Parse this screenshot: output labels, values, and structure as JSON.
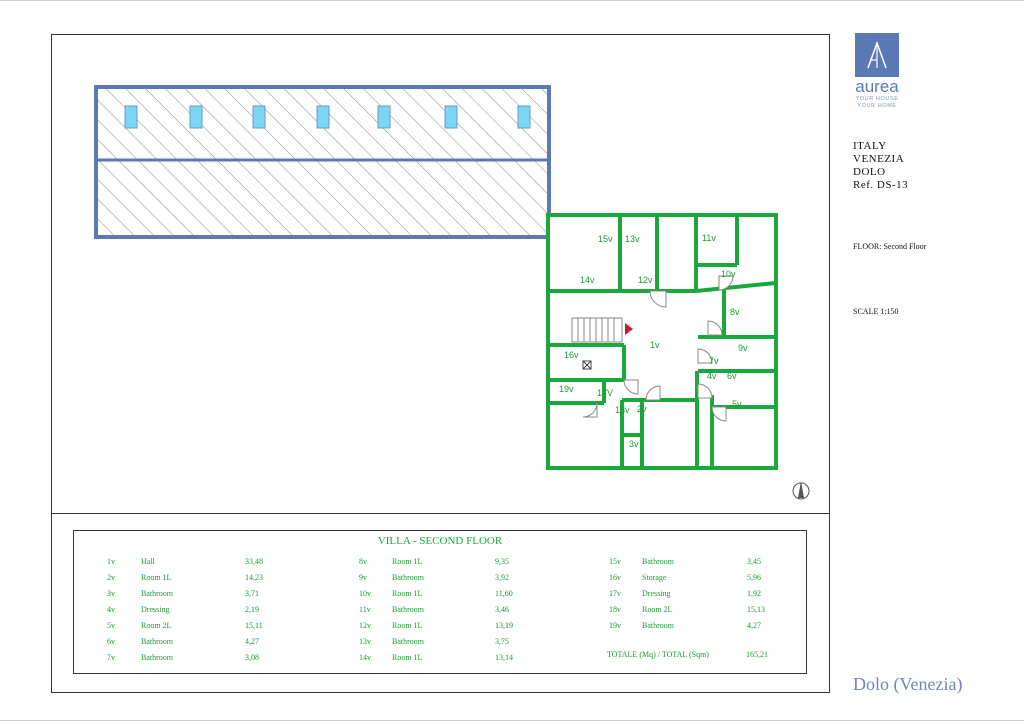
{
  "brand": {
    "name": "aurea",
    "tagline_1": "YOUR HOUSE",
    "tagline_2": "YOUR HOME"
  },
  "location": {
    "country": "ITALY",
    "city": "VENEZIA",
    "town": "DOLO",
    "ref": "Ref. DS-13"
  },
  "floor": "FLOOR: Second Floor",
  "scale": "SCALE 1:150",
  "footer_title": "Dolo (Venezia)",
  "colors": {
    "wall": "#1aa83a",
    "roof": "#5b7ab5",
    "skylight": "#7fd6f2",
    "accent": "#6f86b8"
  },
  "room_labels": [
    "1v",
    "2v",
    "3v",
    "4v",
    "5v",
    "6v",
    "7v",
    "8v",
    "9v",
    "10v",
    "11v",
    "12v",
    "13v",
    "14v",
    "15v",
    "16v",
    "17V",
    "18v",
    "19v"
  ],
  "legend": {
    "title": "VILLA - SECOND FLOOR",
    "columns": [
      [
        {
          "id": "1v",
          "name": "Hall",
          "area": "33,48"
        },
        {
          "id": "2v",
          "name": "Room 1L",
          "area": "14,23"
        },
        {
          "id": "3v",
          "name": "Bathroom",
          "area": "3,71"
        },
        {
          "id": "4v",
          "name": "Dressing",
          "area": "2,19"
        },
        {
          "id": "5v",
          "name": "Room 2L",
          "area": "15,11"
        },
        {
          "id": "6v",
          "name": "Bathroom",
          "area": "4,27"
        },
        {
          "id": "7v",
          "name": "Bathroom",
          "area": "3,08"
        }
      ],
      [
        {
          "id": "8v",
          "name": "Room 1L",
          "area": "9,35"
        },
        {
          "id": "9v",
          "name": "Bathroom",
          "area": "3,92"
        },
        {
          "id": "10v",
          "name": "Room 1L",
          "area": "11,60"
        },
        {
          "id": "11v",
          "name": "Bathroom",
          "area": "3,46"
        },
        {
          "id": "12v",
          "name": "Room 1L",
          "area": "13,19"
        },
        {
          "id": "13v",
          "name": "Bathroom",
          "area": "3,75"
        },
        {
          "id": "14v",
          "name": "Room 1L",
          "area": "13,14"
        }
      ],
      [
        {
          "id": "15v",
          "name": "Bathroom",
          "area": "3,45"
        },
        {
          "id": "16v",
          "name": "Storage",
          "area": "5,96"
        },
        {
          "id": "17v",
          "name": "Dressing",
          "area": "1,92"
        },
        {
          "id": "18v",
          "name": "Room 2L",
          "area": "15,13"
        },
        {
          "id": "19v",
          "name": "Bathroom",
          "area": "4,27"
        }
      ]
    ],
    "total_label": "TOTALE (Mq) / TOTAL (Sqm)",
    "total_value": "165,21"
  }
}
